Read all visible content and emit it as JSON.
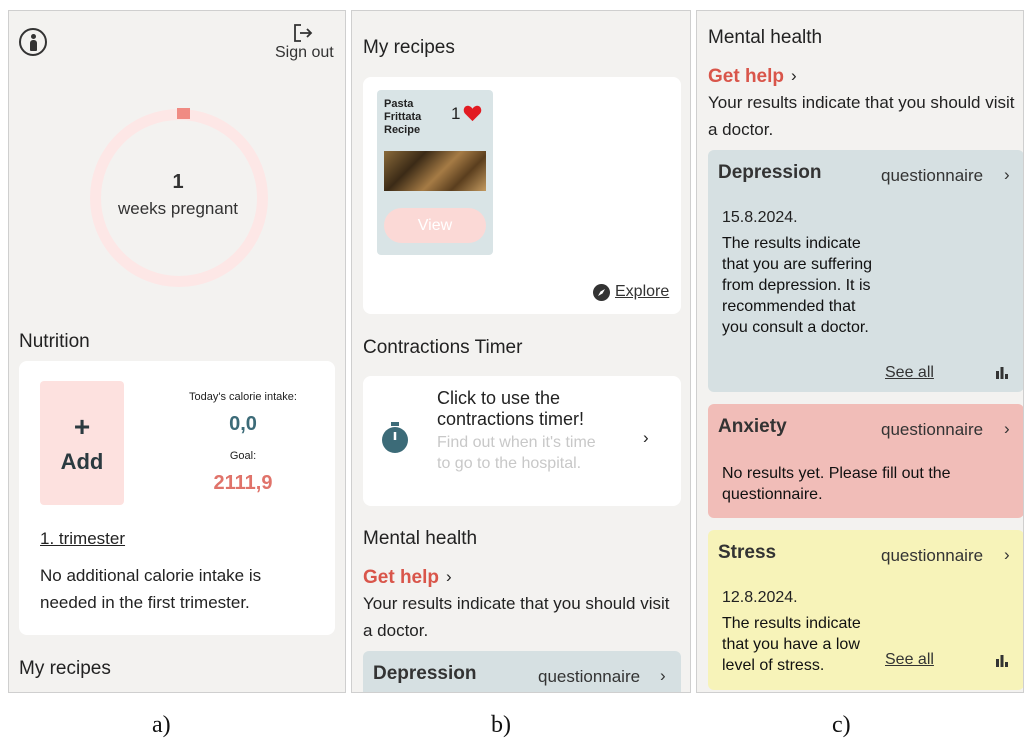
{
  "captions": {
    "a": "a)",
    "b": "b)",
    "c": "c)"
  },
  "colors": {
    "accent_red": "#d9554a",
    "teal": "#3c6b78",
    "salmon": "#e0736a",
    "depression_bg": "#d6e0e2",
    "anxiety_bg": "#f1bdb8",
    "stress_bg": "#f7f3b9"
  },
  "panel_a": {
    "header": {
      "sign_out": "Sign out",
      "profile_icon": "pregnant-person-icon",
      "sign_out_icon": "sign-out-icon"
    },
    "progress": {
      "weeks": "1",
      "label": "weeks pregnant",
      "fraction": 0.025
    },
    "nutrition": {
      "title": "Nutrition",
      "add_plus": "+",
      "add_label": "Add",
      "today_label": "Today's calorie intake:",
      "today_value": "0,0",
      "goal_label": "Goal:",
      "goal_value": "2111,9",
      "trimester_link": "1. trimester",
      "trimester_text": "No additional calorie intake is needed in the first trimester."
    },
    "my_recipes_title": "My recipes"
  },
  "panel_b": {
    "my_recipes_title": "My recipes",
    "recipe": {
      "name": "Pasta Frittata Recipe",
      "likes": "1",
      "view_label": "View"
    },
    "explore_label": "Explore",
    "contractions": {
      "title": "Contractions Timer",
      "cta": "Click to use the contractions timer!",
      "subtitle": "Find out when it's time to go to the hospital.",
      "chevron": "›"
    },
    "mental_health": {
      "title": "Mental health",
      "get_help": "Get help",
      "chevron": "›",
      "results_text": "Your results indicate that you should visit a doctor.",
      "depression_title": "Depression",
      "questionnaire_label": "questionnaire"
    }
  },
  "panel_c": {
    "title": "Mental health",
    "get_help": "Get help",
    "chevron": "›",
    "results_text": "Your results indicate that you should visit a doctor.",
    "questionnaire_label": "questionnaire",
    "see_all": "See all",
    "depression": {
      "title": "Depression",
      "date": "15.8.2024.",
      "text": "The results indicate that you are suffering from depression. It is recommended that you consult a doctor."
    },
    "anxiety": {
      "title": "Anxiety",
      "text": "No results yet. Please fill out the questionnaire."
    },
    "stress": {
      "title": "Stress",
      "date": "12.8.2024.",
      "text": "The results indicate that you have a low level of stress."
    }
  }
}
